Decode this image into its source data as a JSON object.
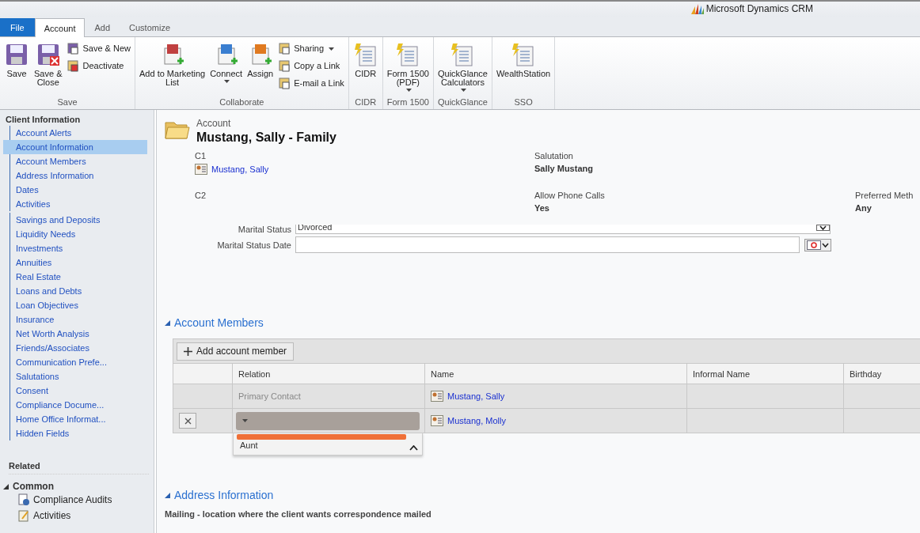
{
  "header": {
    "brand": "Microsoft Dynamics CRM"
  },
  "tabs": [
    {
      "label": "File",
      "kind": "file",
      "selected": false
    },
    {
      "label": "Account",
      "kind": "tab",
      "selected": true
    },
    {
      "label": "Add",
      "kind": "tab",
      "selected": false
    },
    {
      "label": "Customize",
      "kind": "tab",
      "selected": false
    }
  ],
  "ribbon": {
    "groups": [
      {
        "label": "Save",
        "large_buttons": [
          {
            "lines": [
              "Save"
            ],
            "dropdown": false
          },
          {
            "lines": [
              "Save &",
              "Close"
            ],
            "dropdown": false
          }
        ],
        "small_buttons": [
          {
            "label": "Save & New",
            "dropdown": false
          },
          {
            "label": "Deactivate",
            "dropdown": false
          }
        ]
      },
      {
        "label": "Collaborate",
        "large_buttons": [
          {
            "lines": [
              "Add to Marketing",
              "List"
            ],
            "dropdown": false
          },
          {
            "lines": [
              "Connect"
            ],
            "dropdown": true
          },
          {
            "lines": [
              "Assign"
            ],
            "dropdown": false
          }
        ],
        "small_buttons": [
          {
            "label": "Sharing",
            "dropdown": true
          },
          {
            "label": "Copy a Link",
            "dropdown": false
          },
          {
            "label": "E-mail a Link",
            "dropdown": false
          }
        ]
      },
      {
        "label": "CIDR",
        "large_buttons": [
          {
            "lines": [
              "CIDR"
            ],
            "dropdown": false
          }
        ]
      },
      {
        "label": "Form 1500",
        "large_buttons": [
          {
            "lines": [
              "Form 1500",
              "(PDF)"
            ],
            "dropdown": true
          }
        ]
      },
      {
        "label": "QuickGlance",
        "large_buttons": [
          {
            "lines": [
              "QuickGlance",
              "Calculators"
            ],
            "dropdown": true
          }
        ]
      },
      {
        "label": "SSO",
        "large_buttons": [
          {
            "lines": [
              "WealthStation"
            ],
            "dropdown": false
          }
        ]
      }
    ]
  },
  "sidebar": {
    "title": "Client Information",
    "groups": [
      [
        {
          "label": "Account Alerts",
          "selected": false
        },
        {
          "label": "Account Information",
          "selected": true
        },
        {
          "label": "Account Members",
          "selected": false
        },
        {
          "label": "Address Information",
          "selected": false
        },
        {
          "label": "Dates",
          "selected": false
        },
        {
          "label": "Activities",
          "selected": false
        }
      ],
      [
        {
          "label": "Savings and Deposits",
          "selected": false
        },
        {
          "label": "Liquidity Needs",
          "selected": false
        },
        {
          "label": "Investments",
          "selected": false
        },
        {
          "label": "Annuities",
          "selected": false
        },
        {
          "label": "Real Estate",
          "selected": false
        },
        {
          "label": "Loans and Debts",
          "selected": false
        },
        {
          "label": "Loan Objectives",
          "selected": false
        },
        {
          "label": "Insurance",
          "selected": false
        },
        {
          "label": "Net Worth Analysis",
          "selected": false
        },
        {
          "label": "Friends/Associates",
          "selected": false
        },
        {
          "label": "Communication Prefe...",
          "selected": false
        },
        {
          "label": "Salutations",
          "selected": false
        },
        {
          "label": "Consent",
          "selected": false
        },
        {
          "label": "Compliance Docume...",
          "selected": false
        },
        {
          "label": "Home Office Informat...",
          "selected": false
        },
        {
          "label": "Hidden Fields",
          "selected": false
        }
      ]
    ],
    "related": {
      "title": "Related",
      "sections": [
        {
          "title": "Common",
          "expanded": true,
          "children": [
            {
              "label": "Compliance Audits"
            },
            {
              "label": "Activities"
            }
          ]
        }
      ]
    }
  },
  "record": {
    "type": "Account",
    "title": "Mustang, Sally - Family",
    "fields": [
      {
        "label": "C1",
        "value": "Mustang, Sally",
        "kind": "link"
      },
      {
        "label": "Salutation",
        "value": "Sally Mustang",
        "kind": "text"
      },
      {
        "kind": "spacer"
      },
      {
        "label": "C2",
        "kind": "text"
      },
      {
        "label": "Allow Phone Calls",
        "value": "Yes",
        "kind": "text"
      },
      {
        "label": "Preferred Meth",
        "value": "Any",
        "kind": "text"
      }
    ],
    "marital_status": {
      "label": "Marital Status",
      "value": "Divorced"
    },
    "marital_status_date": {
      "label": "Marital Status Date"
    }
  },
  "account_members": {
    "title": "Account Members",
    "expanded": true,
    "add_button": "Add account member",
    "columns": [
      "Relation",
      "Name",
      "Informal Name",
      "Birthday"
    ],
    "rows": [
      {
        "relation": "Primary Contact",
        "name": "Mustang, Sally",
        "removable": false
      },
      {
        "name": "Mustang, Molly",
        "removable": true,
        "dropdown_open": true
      }
    ],
    "dropdown_options": [
      {
        "selected": true
      },
      {
        "label": "Aunt",
        "selected": false
      }
    ]
  },
  "address": {
    "title": "Address Information",
    "expanded": true,
    "caption": "Mailing - location where the client wants correspondence mailed"
  }
}
